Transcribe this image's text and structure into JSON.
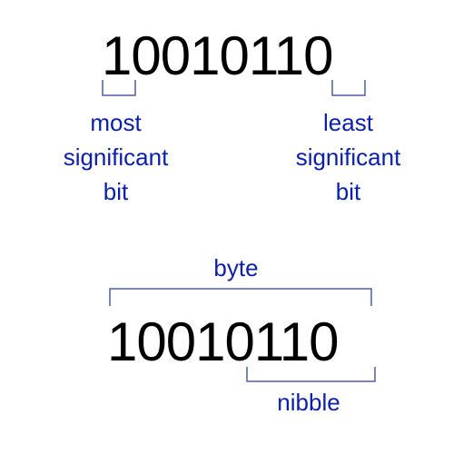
{
  "diagram": {
    "top_binary": "10010110",
    "bottom_binary": "10010110",
    "most_significant_label": [
      "most",
      "significant",
      "bit"
    ],
    "least_significant_label": [
      "least",
      "significant",
      "bit"
    ],
    "byte_label": "byte",
    "nibble_label": "nibble",
    "colors": {
      "text": "#000000",
      "label": "#0b1fa8",
      "bracket": "#4f5f9f"
    }
  }
}
